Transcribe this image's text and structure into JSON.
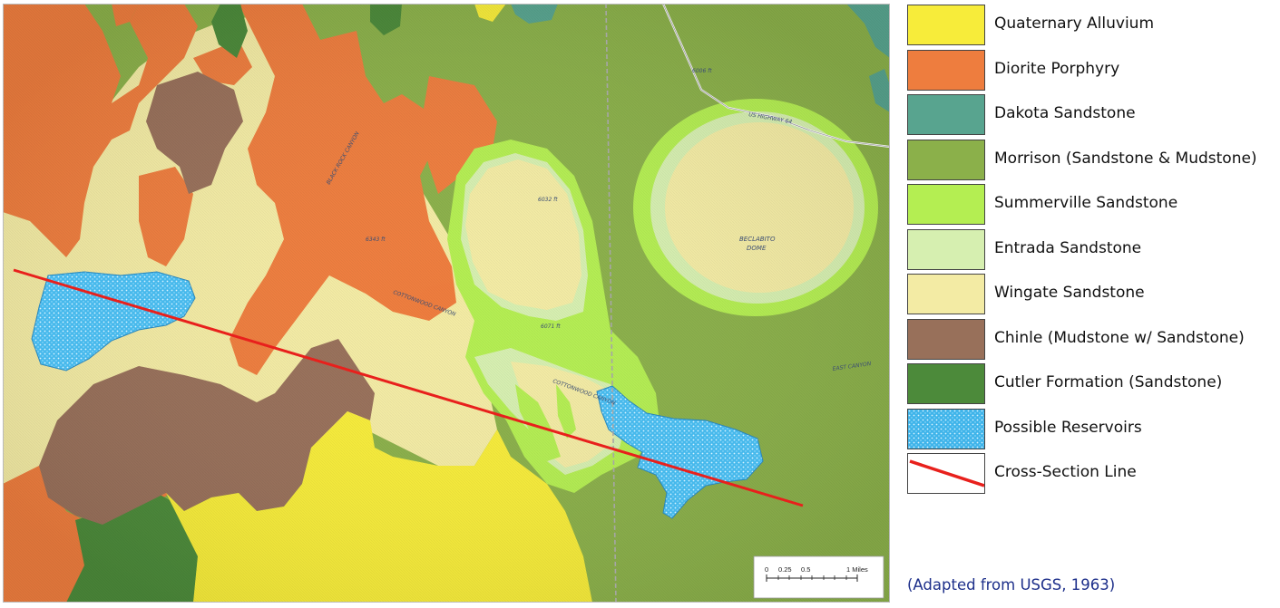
{
  "legend": {
    "items": [
      {
        "label": "Quaternary Alluvium",
        "color": "#f7ec3a"
      },
      {
        "label": "Diorite Porphyry",
        "color": "#ee7d3e"
      },
      {
        "label": "Dakota Sandstone",
        "color": "#58a48f"
      },
      {
        "label": "Morrison (Sandstone & Mudstone)",
        "color": "#8bb04a"
      },
      {
        "label": "Summerville Sandstone",
        "color": "#b4ee52"
      },
      {
        "label": "Entrada Sandstone",
        "color": "#d6efb0"
      },
      {
        "label": "Wingate Sandstone",
        "color": "#f3eba4"
      },
      {
        "label": "Chinle (Mudstone w/ Sandstone)",
        "color": "#98705a"
      },
      {
        "label": "Cutler Formation (Sandstone)",
        "color": "#4c8a3a"
      },
      {
        "label": "Possible Reservoirs",
        "color": "#3fb4ea"
      },
      {
        "label": "Cross-Section Line",
        "color": "#e8201c"
      }
    ]
  },
  "map": {
    "scale_bar": {
      "ticks": [
        "0",
        "0.25",
        "0.5",
        "1 Miles"
      ]
    },
    "labels": {
      "beclabito_dome_1": "BECLABITO",
      "beclabito_dome_2": "DOME",
      "cottonwood_canyon_1": "COTTONWOOD CANYON",
      "cottonwood_canyon_2": "COTTONWOOD CANYON",
      "black_rock_canyon": "BLACK ROCK CANYON",
      "east_canyon": "EAST CANYON",
      "us_highway": "US HIGHWAY 64",
      "peak_1": "6032 ft",
      "peak_2": "6071 ft",
      "peak_3": "6006 ft",
      "peak_4": "6343 ft"
    }
  },
  "credit": "(Adapted from USGS, 1963)"
}
